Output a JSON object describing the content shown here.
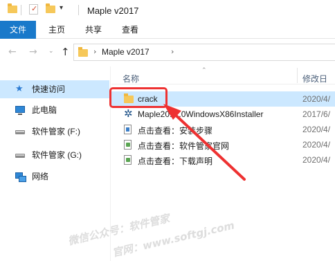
{
  "window": {
    "title": "Maple v2017",
    "quick_access_dropdown": "▾"
  },
  "ribbon": {
    "tabs": [
      {
        "label": "文件",
        "active": true
      },
      {
        "label": "主页"
      },
      {
        "label": "共享"
      },
      {
        "label": "查看"
      }
    ]
  },
  "navigation": {
    "back": "←",
    "forward": "→",
    "recent": "⌄",
    "up": "↑",
    "address": "Maple v2017",
    "chevron": "›"
  },
  "sidebar": {
    "items": [
      {
        "label": "快速访问",
        "icon": "star-icon",
        "active": true
      },
      {
        "label": "此电脑",
        "icon": "pc-icon"
      },
      {
        "label": "软件管家 (F:)",
        "icon": "drive-icon"
      },
      {
        "label": "软件管家 (G:)",
        "icon": "drive-icon"
      },
      {
        "label": "网络",
        "icon": "network-icon"
      }
    ]
  },
  "file_list": {
    "columns": {
      "name": "名称",
      "modified": "修改日"
    },
    "sort_indicator": "⌃",
    "rows": [
      {
        "name": "crack",
        "modified": "2020/4/",
        "icon": "folder-icon",
        "selected": true
      },
      {
        "name": "Maple2017.0WindowsX86Installer",
        "modified": "2017/6/",
        "icon": "maple-installer-icon"
      },
      {
        "name": "点击查看：安装步骤",
        "modified": "2020/4/",
        "icon": "document-icon"
      },
      {
        "name": "点击查看：软件管家官网",
        "modified": "2020/4/",
        "icon": "shortcut-icon"
      },
      {
        "name": "点击查看：下载声明",
        "modified": "2020/4/",
        "icon": "shortcut-icon"
      }
    ]
  },
  "watermark": {
    "line1": "微信公众号：软件管家",
    "line2": "官网：www.softgj.com"
  },
  "colors": {
    "accent": "#1979ca",
    "selection": "#cce8ff",
    "annotation": "#ee3131"
  }
}
